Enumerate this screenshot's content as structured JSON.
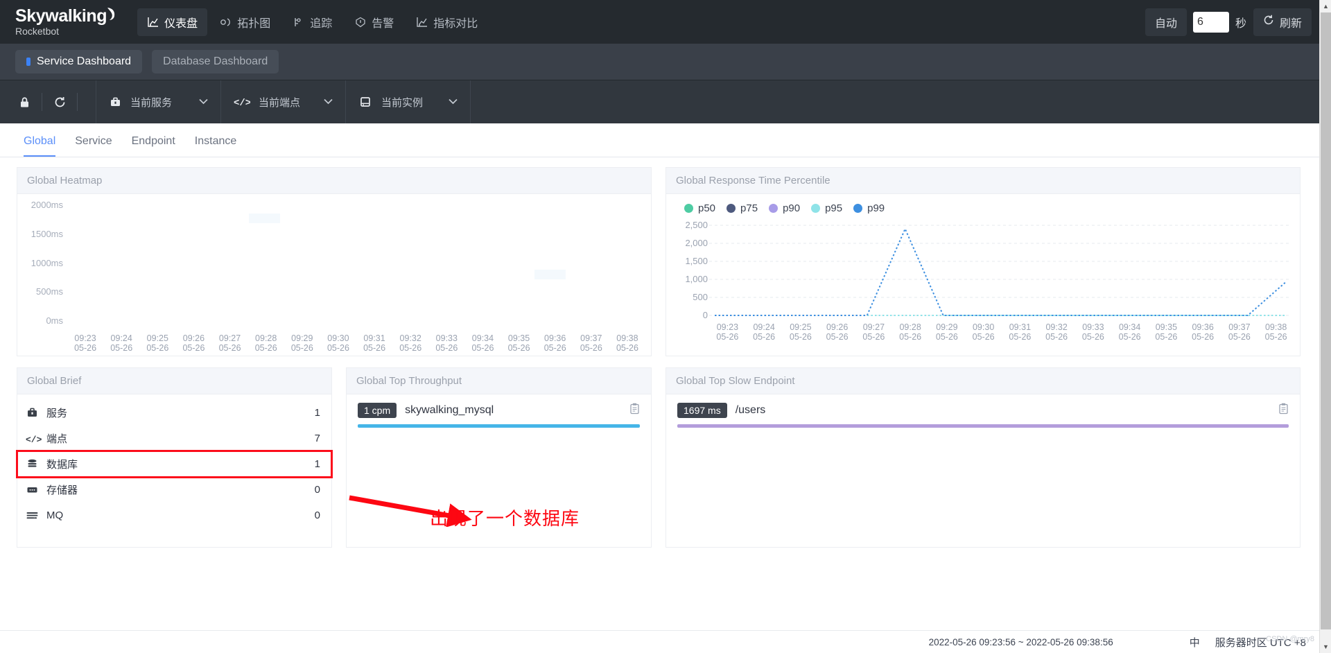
{
  "header": {
    "brand_main": "Skywalking",
    "brand_sub": "Rocketbot",
    "nav": [
      {
        "label": "仪表盘",
        "icon": "chart-icon",
        "active": true
      },
      {
        "label": "拓扑图",
        "icon": "topology-icon",
        "active": false
      },
      {
        "label": "追踪",
        "icon": "trace-icon",
        "active": false
      },
      {
        "label": "告警",
        "icon": "alarm-icon",
        "active": false
      },
      {
        "label": "指标对比",
        "icon": "compare-icon",
        "active": false
      }
    ],
    "auto_label": "自动",
    "interval_value": "6",
    "seconds_label": "秒",
    "refresh_label": "刷新"
  },
  "dashboard_tabs": [
    {
      "label": "Service Dashboard",
      "active": true
    },
    {
      "label": "Database Dashboard",
      "active": false
    }
  ],
  "selector_bar": {
    "lock_icon": "lock-icon",
    "reload_icon": "reload-icon",
    "selects": [
      {
        "label": "当前服务",
        "icon": "service-icon"
      },
      {
        "label": "当前端点",
        "icon": "endpoint-icon"
      },
      {
        "label": "当前实例",
        "icon": "instance-icon"
      }
    ]
  },
  "sub_tabs": [
    {
      "label": "Global",
      "active": true
    },
    {
      "label": "Service",
      "active": false
    },
    {
      "label": "Endpoint",
      "active": false
    },
    {
      "label": "Instance",
      "active": false
    }
  ],
  "panels": {
    "heatmap_title": "Global Heatmap",
    "percentile_title": "Global Response Time Percentile",
    "brief_title": "Global Brief",
    "throughput_title": "Global Top Throughput",
    "slow_endpoint_title": "Global Top Slow Endpoint"
  },
  "brief": {
    "rows": [
      {
        "icon": "service-icon",
        "label": "服务",
        "value": "1",
        "highlight": false
      },
      {
        "icon": "endpoint-icon",
        "label": "端点",
        "value": "7",
        "highlight": false
      },
      {
        "icon": "database-icon",
        "label": "数据库",
        "value": "1",
        "highlight": true
      },
      {
        "icon": "cache-icon",
        "label": "存储器",
        "value": "0",
        "highlight": false
      },
      {
        "icon": "mq-icon",
        "label": "MQ",
        "value": "0",
        "highlight": false
      }
    ]
  },
  "top_throughput": {
    "items": [
      {
        "badge": "1 cpm",
        "name": "skywalking_mysql",
        "bar_color": "#45b5e8",
        "bar_pct": 100
      }
    ],
    "copy_icon": "clipboard-icon"
  },
  "top_slow_endpoint": {
    "items": [
      {
        "badge": "1697 ms",
        "name": "/users",
        "bar_color": "#b39ddb",
        "bar_pct": 100
      }
    ],
    "copy_icon": "clipboard-icon"
  },
  "annotation": {
    "text": "出现了一个数据库",
    "color": "#fd0712"
  },
  "footer": {
    "time_range": "2022-05-26 09:23:56 ~ 2022-05-26 09:38:56",
    "lang": "中",
    "timezone": "服务器时区 UTC +8",
    "watermark": "CSDN @mry8"
  },
  "chart_data": [
    {
      "type": "heatmap",
      "title": "Global Heatmap",
      "xlabel": "",
      "ylabel": "",
      "ylim": [
        0,
        2250
      ],
      "ytick_labels": [
        "2000ms",
        "1500ms",
        "1000ms",
        "500ms",
        "0ms"
      ],
      "ytick_values": [
        2000,
        1500,
        1000,
        500,
        0
      ],
      "x": [
        "09:23\n05-26",
        "09:24\n05-26",
        "09:25\n05-26",
        "09:26\n05-26",
        "09:27\n05-26",
        "09:28\n05-26",
        "09:29\n05-26",
        "09:30\n05-26",
        "09:31\n05-26",
        "09:32\n05-26",
        "09:33\n05-26",
        "09:34\n05-26",
        "09:35\n05-26",
        "09:36\n05-26",
        "09:37\n05-26",
        "09:38\n05-26"
      ],
      "cells": [
        {
          "x_index": 5,
          "y_value": 2000,
          "intensity": 1,
          "color": "#f4f9fd"
        },
        {
          "x_index": 13,
          "y_value": 900,
          "intensity": 1,
          "color": "#f4f9fd"
        }
      ],
      "grid": false
    },
    {
      "type": "line",
      "title": "Global Response Time Percentile",
      "xlabel": "",
      "ylabel": "",
      "ylim": [
        0,
        2500
      ],
      "ytick_labels": [
        "2,500",
        "2,000",
        "1,500",
        "1,000",
        "500",
        "0"
      ],
      "ytick_values": [
        2500,
        2000,
        1500,
        1000,
        500,
        0
      ],
      "grid": true,
      "legend_position": "top-left",
      "categories": [
        "09:23\n05-26",
        "09:24\n05-26",
        "09:25\n05-26",
        "09:26\n05-26",
        "09:27\n05-26",
        "09:28\n05-26",
        "09:29\n05-26",
        "09:30\n05-26",
        "09:31\n05-26",
        "09:32\n05-26",
        "09:33\n05-26",
        "09:34\n05-26",
        "09:35\n05-26",
        "09:36\n05-26",
        "09:37\n05-26",
        "09:38\n05-26"
      ],
      "series": [
        {
          "name": "p50",
          "color": "#4ecca3",
          "values": [
            0,
            0,
            0,
            0,
            0,
            0,
            0,
            0,
            0,
            0,
            0,
            0,
            0,
            0,
            0,
            0
          ]
        },
        {
          "name": "p75",
          "color": "#4e5a7e",
          "values": [
            0,
            0,
            0,
            0,
            0,
            0,
            0,
            0,
            0,
            0,
            0,
            0,
            0,
            0,
            0,
            0
          ]
        },
        {
          "name": "p90",
          "color": "#a89ce8",
          "values": [
            0,
            0,
            0,
            0,
            0,
            0,
            0,
            0,
            0,
            0,
            0,
            0,
            0,
            0,
            0,
            0
          ]
        },
        {
          "name": "p95",
          "color": "#8fe3e8",
          "values": [
            0,
            0,
            0,
            0,
            0,
            0,
            0,
            0,
            0,
            0,
            0,
            0,
            0,
            0,
            0,
            0
          ]
        },
        {
          "name": "p99",
          "color": "#3d8fe0",
          "values": [
            0,
            0,
            0,
            0,
            0,
            2400,
            0,
            0,
            0,
            0,
            0,
            0,
            0,
            0,
            0,
            930
          ]
        }
      ]
    }
  ]
}
